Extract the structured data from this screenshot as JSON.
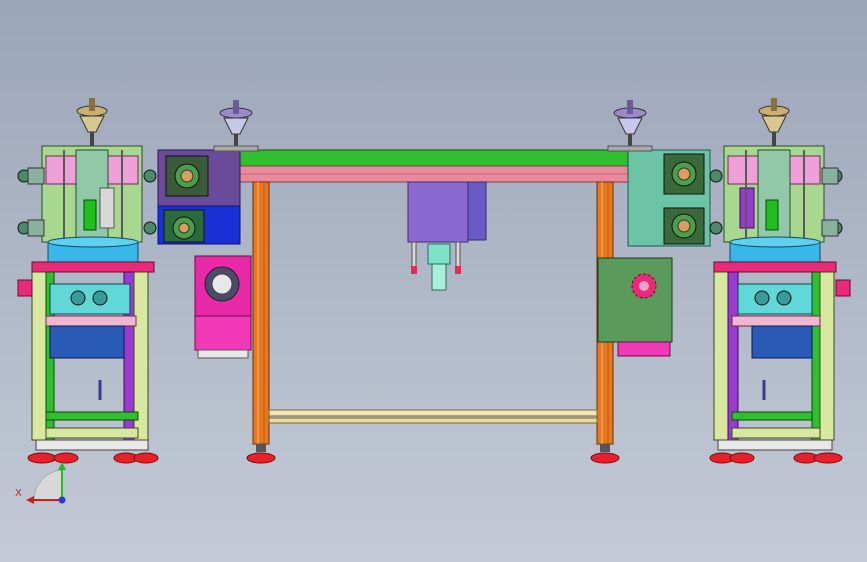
{
  "viewport": {
    "background_top": "#9aa5b8",
    "background_bottom": "#c4cad6"
  },
  "colors": {
    "frame_green": "#2fbf2f",
    "rail_pink": "#e88a9a",
    "slider_purple": "#8a6ad0",
    "motor_magenta": "#e82aa8",
    "panel_teal": "#6cc4a6",
    "panel_olive": "#5a9a5a",
    "panel_navy": "#1b2fd6",
    "leg_orange": "#e8781e",
    "foot_red": "#e8202a",
    "axis_x": "#cc1f1f",
    "axis_y": "#1fbf1f",
    "axis_z": "#1f3fcc"
  },
  "triad": {
    "x_label": "X"
  },
  "icons": {
    "triad": "coordinate-triad-icon",
    "knob": "vertical-knob-icon",
    "gear": "gear-icon",
    "bolt_flange": "bolt-flange-icon"
  }
}
